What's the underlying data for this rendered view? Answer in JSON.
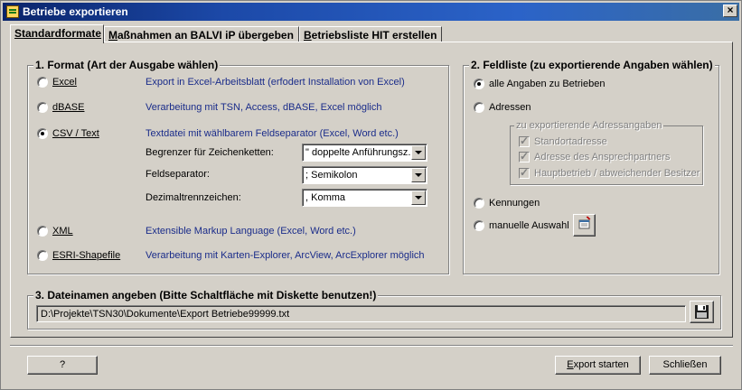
{
  "window": {
    "title": "Betriebe exportieren",
    "close_glyph": "×"
  },
  "tabs": [
    {
      "label": "Standardformate",
      "active": true
    },
    {
      "label": "Maßnahmen an BALVI iP übergeben",
      "underline": "M",
      "rest": "aßnahmen an BALVI iP übergeben"
    },
    {
      "label": "Betriebsliste HIT erstellen",
      "underline": "B",
      "rest": "etriebsliste HIT erstellen"
    }
  ],
  "format_group": {
    "title": "1. Format (Art der Ausgabe wählen)",
    "options": [
      {
        "label": "Excel",
        "desc": "Export in Excel-Arbeitsblatt (erfodert Installation von Excel)",
        "checked": false
      },
      {
        "label": "dBASE",
        "desc": "Verarbeitung mit TSN, Access, dBASE, Excel möglich",
        "checked": false
      },
      {
        "label": "CSV / Text",
        "desc": "Textdatei mit wählbarem Feldseparator (Excel, Word etc.)",
        "checked": true
      },
      {
        "label": "XML",
        "desc": "Extensible Markup Language (Excel, Word etc.)",
        "checked": false
      },
      {
        "label": "ESRI-Shapefile",
        "desc": "Verarbeitung mit Karten-Explorer, ArcView, ArcExplorer möglich",
        "checked": false
      }
    ],
    "csv_settings": [
      {
        "label": "Begrenzer für Zeichenketten:",
        "value": "\" doppelte Anführungsz."
      },
      {
        "label": "Feldseparator:",
        "value": "; Semikolon"
      },
      {
        "label": "Dezimaltrennzeichen:",
        "value": ", Komma"
      }
    ]
  },
  "field_group": {
    "title": "2. Feldliste (zu exportierende Angaben wählen)",
    "options": {
      "all": {
        "label": "alle Angaben zu Betrieben",
        "checked": true
      },
      "addresses": {
        "label": "Adressen",
        "checked": false
      },
      "ids": {
        "label": "Kennungen",
        "checked": false
      },
      "manual": {
        "label": "manuelle Auswahl",
        "checked": false
      }
    },
    "address_subgroup": {
      "title": "zu exportierende Adressangaben",
      "items": [
        {
          "label": "Standortadresse",
          "checked": true
        },
        {
          "label": "Adresse des Ansprechpartners",
          "checked": true
        },
        {
          "label": "Hauptbetrieb / abweichender Besitzer",
          "checked": true
        }
      ]
    }
  },
  "file_group": {
    "title": "3. Dateinamen angeben (Bitte Schaltfläche mit Diskette benutzen!)",
    "path": "D:\\Projekte\\TSN30\\Dokumente\\Export Betriebe99999.txt"
  },
  "footer": {
    "help_label": "?",
    "export_label": "Export starten",
    "export_underline": "E",
    "export_rest": "xport starten",
    "close_label": "Schließen"
  }
}
